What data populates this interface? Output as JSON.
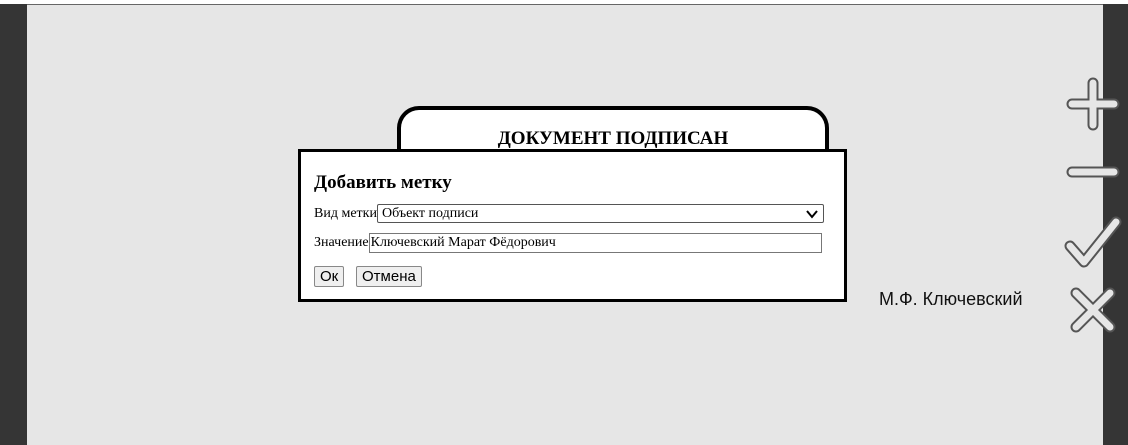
{
  "document": {
    "stamp_title": "ДОКУМЕНТ ПОДПИСАН",
    "signer_name": "М.Ф. Ключевский"
  },
  "dialog": {
    "title": "Добавить метку",
    "type_label": "Вид метки",
    "type_selected": "Объект подписи",
    "value_label": "Значение",
    "value_text": "Ключевский Марат Фёдорович",
    "ok_label": "Ок",
    "cancel_label": "Отмена"
  },
  "toolbar": {
    "icons": [
      "zoom-in-icon",
      "zoom-out-icon",
      "confirm-check-icon",
      "close-icon"
    ]
  },
  "colors": {
    "page_bg": "#e6e6e6",
    "frame_bg": "#353535",
    "icon_color": "#9a9a9a"
  }
}
